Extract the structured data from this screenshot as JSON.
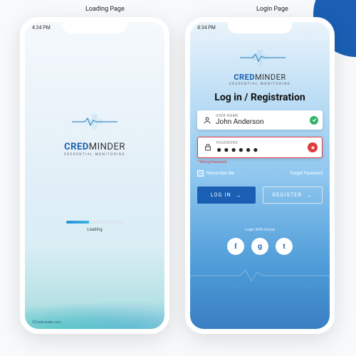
{
  "labels": {
    "loading_page": "Loading Page",
    "login_page": "Login Page"
  },
  "status": {
    "time": "4:34 PM"
  },
  "brand": {
    "part1": "CRED",
    "part2": "MINDER",
    "tagline": "CREDENTIAL MONITORING"
  },
  "loading": {
    "text": "Loading",
    "footer": "©Credminder.com"
  },
  "login": {
    "heading": "Log in / Registration",
    "username_label": "USER NAME",
    "username_value": "John Anderson",
    "password_label": "PASSWORD",
    "password_mask": "●●●●●●",
    "error_text": "* Wrong Password",
    "remember": "Remember Me",
    "forgot": "Forgot Password",
    "login_btn": "LOG IN",
    "register_btn": "REGISTER",
    "social_label": "Login With Social",
    "social": {
      "fb": "f",
      "google": "g",
      "twitter": "t"
    }
  }
}
